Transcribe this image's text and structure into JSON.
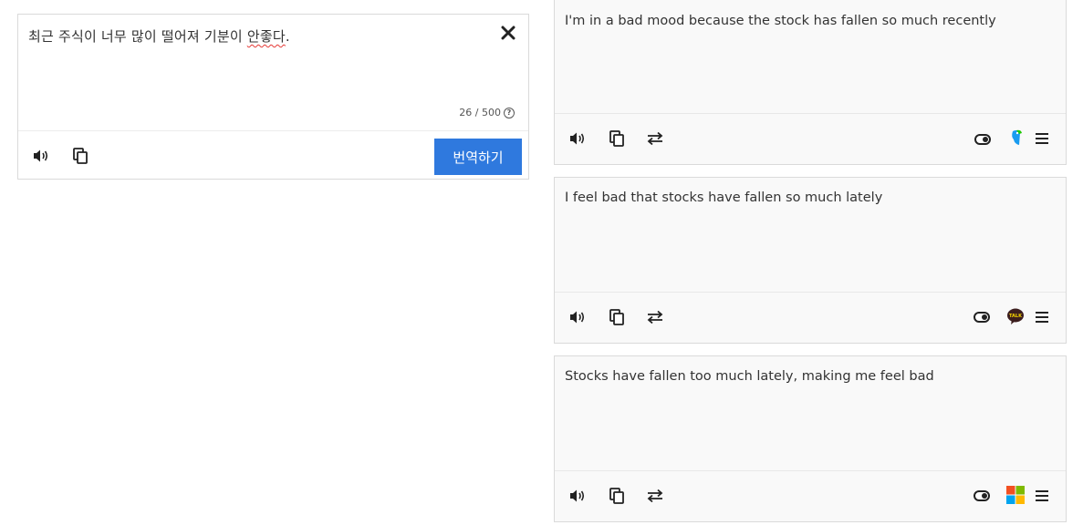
{
  "source": {
    "text_before_underline": "최근 주식이 너무 많이 떨어져 기분이 ",
    "text_underlined": "안좋다",
    "text_after_underline": ".",
    "char_count": "26 / 500",
    "help_glyph": "?",
    "close_glyph": "✕",
    "translate_label": "번역하기"
  },
  "results": [
    {
      "text": "I'm in a bad mood because the stock has fallen so much recently",
      "engine_icon": "papago-parrot-icon"
    },
    {
      "text": "I feel bad that stocks have fallen so much lately",
      "engine_icon": "kakao-talk-icon",
      "engine_badge": "TALK"
    },
    {
      "text": "Stocks have fallen too much lately, making me feel bad",
      "engine_icon": "microsoft-icon"
    }
  ],
  "colors": {
    "translate_button": "#2f79de",
    "result_background": "#f9f9f9",
    "border": "#dadada",
    "spell_underline": "#e53935",
    "kakao_bubble": "#3c1e1e",
    "kakao_text": "#f5d300",
    "papago_green": "#1ec800",
    "papago_blue": "#1a9cf0",
    "ms_red": "#f25022",
    "ms_green": "#7fba00",
    "ms_blue": "#00a4ef",
    "ms_yellow": "#ffb900"
  }
}
